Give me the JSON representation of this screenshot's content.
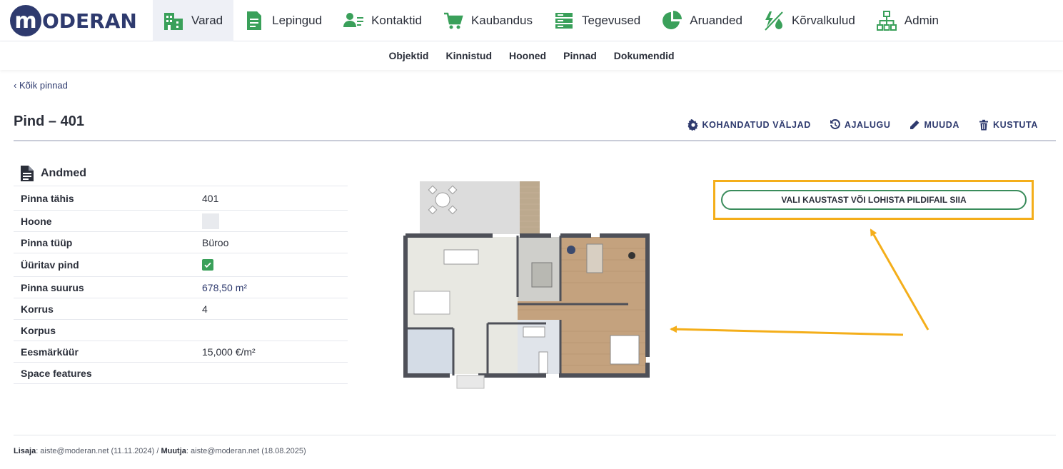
{
  "logo": {
    "mark": "m",
    "text": "ODERAN"
  },
  "nav": [
    {
      "label": "Varad",
      "icon": "buildings-icon",
      "active": true
    },
    {
      "label": "Lepingud",
      "icon": "document-icon"
    },
    {
      "label": "Kontaktid",
      "icon": "contact-card-icon"
    },
    {
      "label": "Kaubandus",
      "icon": "cart-icon"
    },
    {
      "label": "Tegevused",
      "icon": "tasks-icon"
    },
    {
      "label": "Aruanded",
      "icon": "pie-chart-icon"
    },
    {
      "label": "Kõrvalkulud",
      "icon": "utilities-icon"
    },
    {
      "label": "Admin",
      "icon": "org-chart-icon"
    }
  ],
  "subnav": [
    "Objektid",
    "Kinnistud",
    "Hooned",
    "Pinnad",
    "Dokumendid"
  ],
  "back_link": "‹ Kõik pinnad",
  "page_title": "Pind – 401",
  "actions": {
    "custom_fields": "KOHANDATUD VÄLJAD",
    "history": "AJALUGU",
    "edit": "MUUDA",
    "delete": "KUSTUTA"
  },
  "section_title": "Andmed",
  "fields": {
    "pinna_tahis": {
      "label": "Pinna tähis",
      "value": "401"
    },
    "hoone": {
      "label": "Hoone",
      "value": ""
    },
    "pinna_tuup": {
      "label": "Pinna tüüp",
      "value": "Büroo"
    },
    "uuritav": {
      "label": "Üüritav pind",
      "checked": true
    },
    "pinna_suurus": {
      "label": "Pinna suurus",
      "value": "678,50 m²"
    },
    "korrus": {
      "label": "Korrus",
      "value": "4"
    },
    "korpus": {
      "label": "Korpus",
      "value": ""
    },
    "eesmarkuur": {
      "label": "Eesmärküür",
      "value": "15,000 €/m²"
    },
    "space_features": {
      "label": "Space features",
      "value": ""
    }
  },
  "upload_label": "VALI KAUSTAST VÕI LOHISTA PILDIFAIL SIIA",
  "footer": {
    "added_label": "Lisaja",
    "added_value": ": aiste@moderan.net (11.11.2024) / ",
    "changed_label": "Muutja",
    "changed_value": ": aiste@moderan.net (18.08.2025)"
  },
  "colors": {
    "brand": "#2e3a6e",
    "accent_highlight": "#f4ae1a",
    "success": "#3aa05a",
    "nav_active_bg": "#eef0f6"
  }
}
